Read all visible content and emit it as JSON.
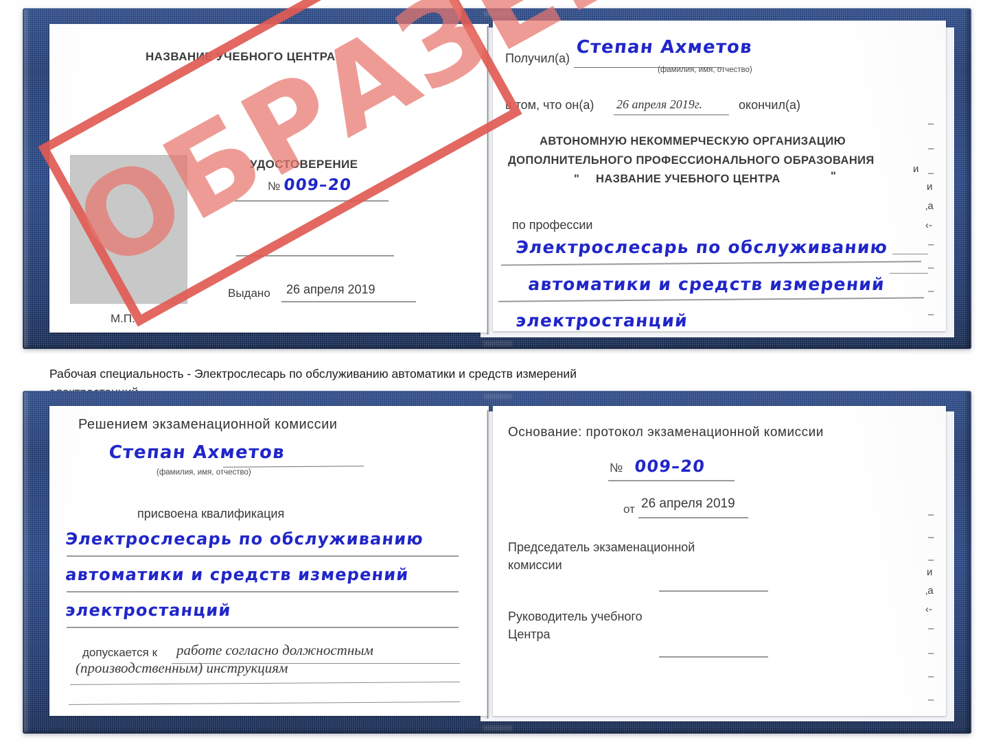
{
  "meta": {
    "doc_type": "Удостоверение (образец)",
    "stamp_word": "ОБРАЗЕЦ",
    "accent_blue": "#27417c",
    "stamp_red": "#e05b54",
    "hand_ink": "#2026c9",
    "photo_placeholder": "#c8c8c8"
  },
  "caption": {
    "line1": "Рабочая специальность - Электрослесарь по обслуживанию автоматики и средств измерений",
    "line2": "электростанций"
  },
  "cert_top": {
    "left_page": {
      "center_name": "НАЗВАНИЕ УЧЕБНОГО ЦЕНТРА",
      "doc_title": "УДОСТОВЕРЕНИЕ",
      "number_label": "№",
      "number_value": "009–20",
      "issued_label": "Выдано",
      "issued_value": "26 апреля 2019",
      "seal_label": "М.П."
    },
    "right_page": {
      "received_label": "Получил(а)",
      "received_value": "Степан Ахметов",
      "name_hint": "(фамилия, имя, отчество)",
      "in_that_label": "в том, что он(а)",
      "in_that_value": "26 апреля 2019г.",
      "finished_label": "окончил(а)",
      "org_line1": "АВТОНОМНУЮ НЕКОММЕРЧЕСКУЮ ОРГАНИЗАЦИЮ",
      "org_line2": "ДОПОЛНИТЕЛЬНОГО ПРОФЕССИОНАЛЬНОГО ОБРАЗОВАНИЯ",
      "org_quote_open": "\"",
      "org_line3": "НАЗВАНИЕ УЧЕБНОГО ЦЕНТРА",
      "org_quote_close": "\"",
      "profession_label": "по профессии",
      "profession_line1": "Электрослесарь по обслуживанию",
      "profession_line2": "автоматики и средств измерений",
      "profession_line3": "электростанций",
      "edge_fragments": [
        "–",
        "–",
        "–",
        "и",
        "‚а",
        "‹-",
        "–",
        "–",
        "–",
        "–"
      ]
    }
  },
  "cert_bottom": {
    "left_page": {
      "decision_title": "Решением экзаменационной комиссии",
      "name_value": "Степан Ахметов",
      "name_hint": "(фамилия, имя, отчество)",
      "qualification_label": "присвоена квалификация",
      "qualification_line1": "Электрослесарь по обслуживанию",
      "qualification_line2": "автоматики и средств измерений",
      "qualification_line3": "электростанций",
      "allowed_label": "допускается к",
      "allowed_value_line1": "работе согласно должностным",
      "allowed_value_line2": "(производственным) инструкциям"
    },
    "right_page": {
      "basis_label": "Основание: протокол экзаменационной комиссии",
      "number_label": "№",
      "number_value": "009–20",
      "date_label": "от",
      "date_value": "26 апреля 2019",
      "chair_line1": "Председатель экзаменационной",
      "chair_line2": "комиссии",
      "head_line1": "Руководитель учебного",
      "head_line2": "Центра",
      "edge_fragments": [
        "–",
        "–",
        "–",
        "и",
        "‚а",
        "‹-",
        "–",
        "–",
        "–",
        "–"
      ]
    }
  }
}
